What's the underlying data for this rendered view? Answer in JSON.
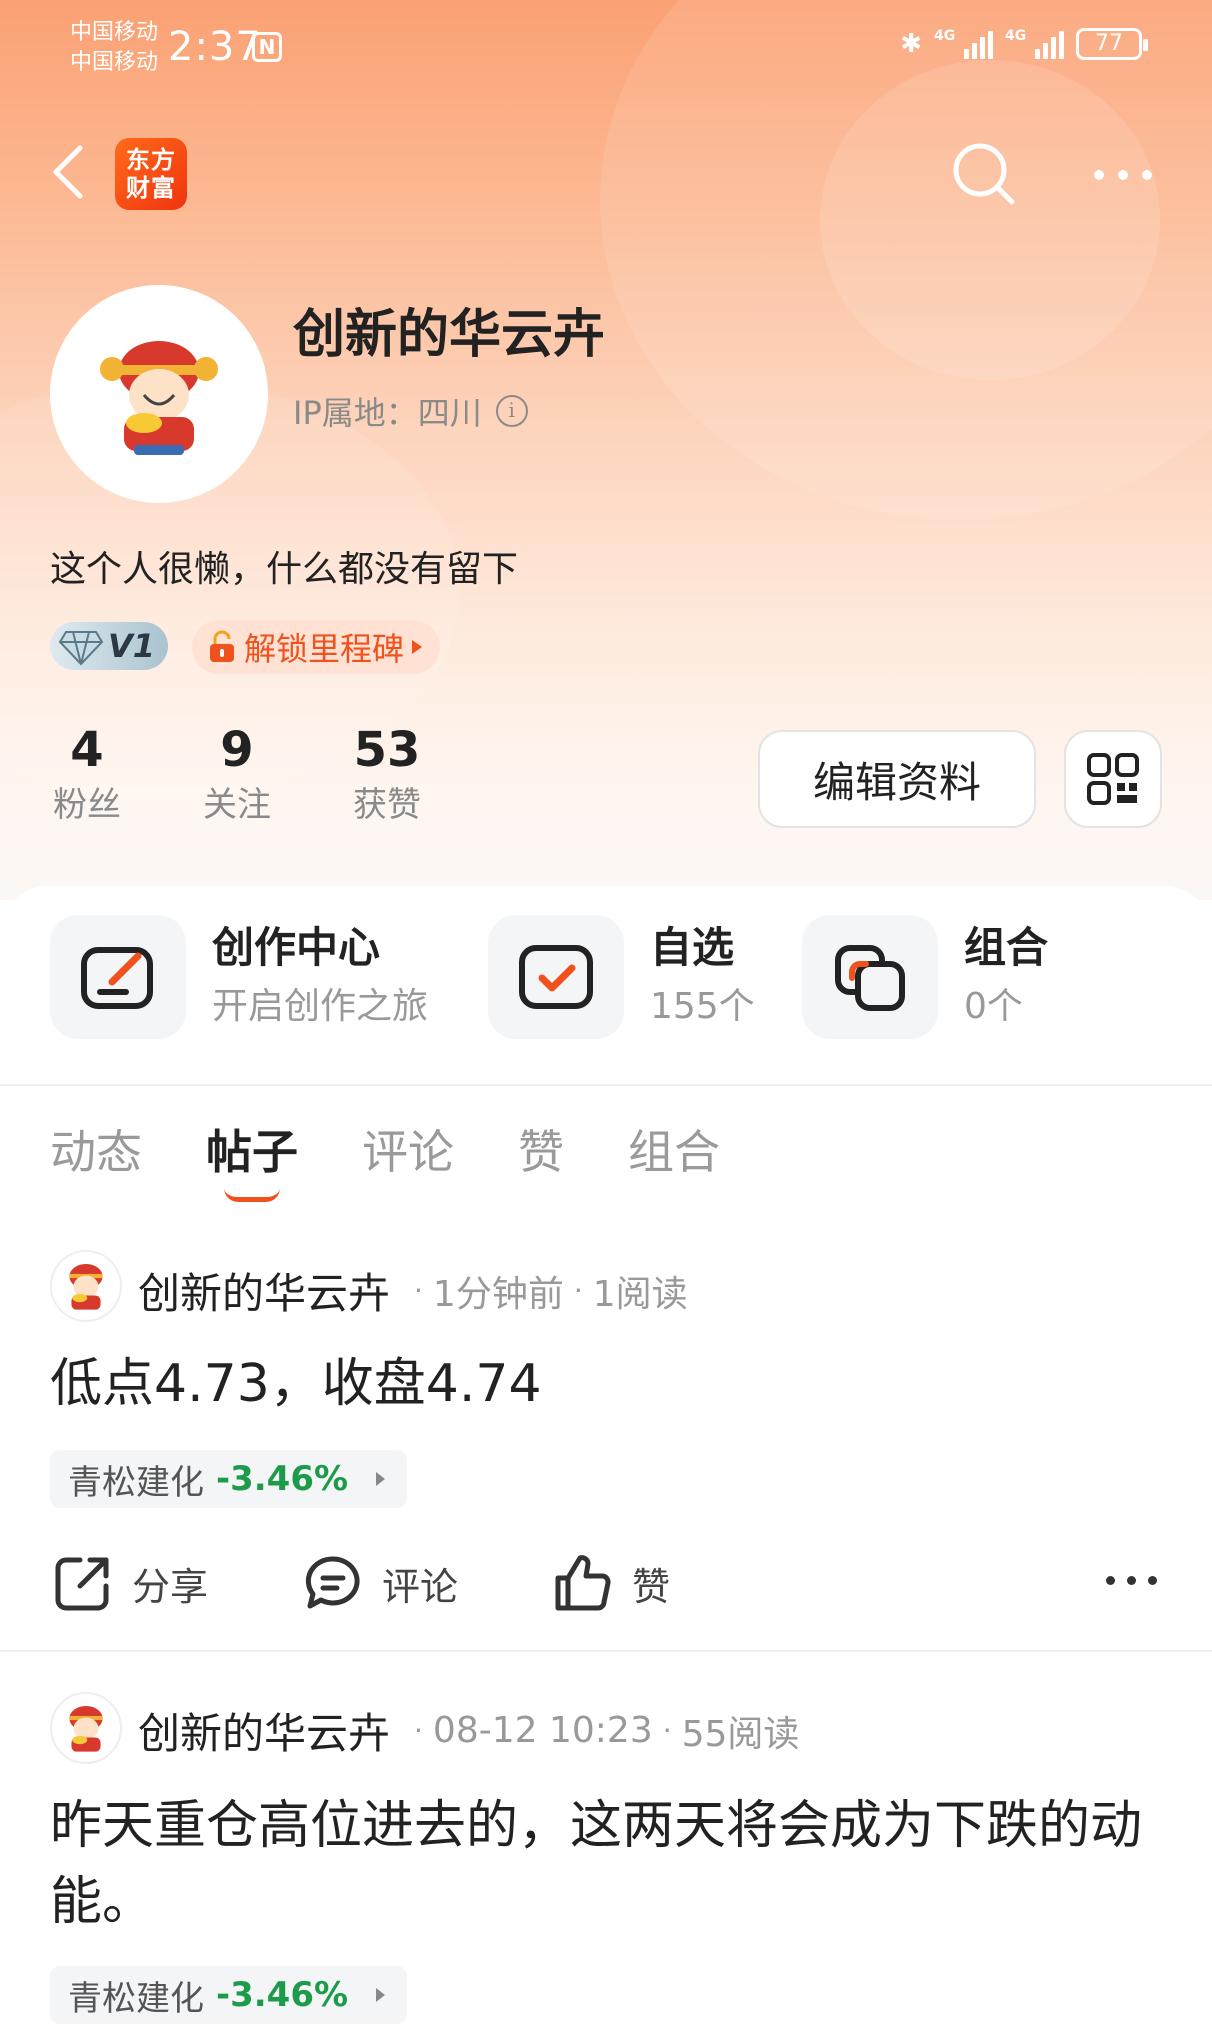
{
  "status_bar": {
    "carrier_1": "中国移动",
    "carrier_2": "中国移动",
    "time": "2:37",
    "nfc": "N",
    "network_1": "4G",
    "network_2": "4G",
    "battery": "77"
  },
  "nav": {
    "logo_line1": "东方",
    "logo_line2": "财富",
    "icons": [
      "back-icon",
      "search-icon",
      "more-icon"
    ]
  },
  "profile": {
    "username": "创新的华云卉",
    "ip_label": "IP属地：四川",
    "bio": "这个人很懒，什么都没有留下",
    "level": "V1",
    "milestone": "解锁里程碑",
    "edit_button": "编辑资料"
  },
  "stats": [
    {
      "num": "4",
      "label": "粉丝"
    },
    {
      "num": "9",
      "label": "关注"
    },
    {
      "num": "53",
      "label": "获赞"
    }
  ],
  "shortcuts": [
    {
      "title": "创作中心",
      "subtitle": "开启创作之旅"
    },
    {
      "title": "自选",
      "subtitle": "155个"
    },
    {
      "title": "组合",
      "subtitle": "0个"
    }
  ],
  "tabs": [
    "动态",
    "帖子",
    "评论",
    "赞",
    "组合"
  ],
  "active_tab": "帖子",
  "posts": [
    {
      "author": "创新的华云卉",
      "time": "1分钟前",
      "reads": "1阅读",
      "text": "低点4.73，收盘4.74",
      "stock_name": "青松建化",
      "stock_change": "-3.46%"
    },
    {
      "author": "创新的华云卉",
      "time": "08-12 10:23",
      "reads": "55阅读",
      "text": "昨天重仓高位进去的，这两天将会成为下跌的动能。",
      "stock_name": "青松建化",
      "stock_change": "-3.46%"
    }
  ],
  "actions": {
    "share": "分享",
    "comment": "评论",
    "like": "赞"
  },
  "colors": {
    "brand": "#f0521d",
    "header_gradient_top": "#fba174",
    "stock_down": "#1e9b4a"
  }
}
